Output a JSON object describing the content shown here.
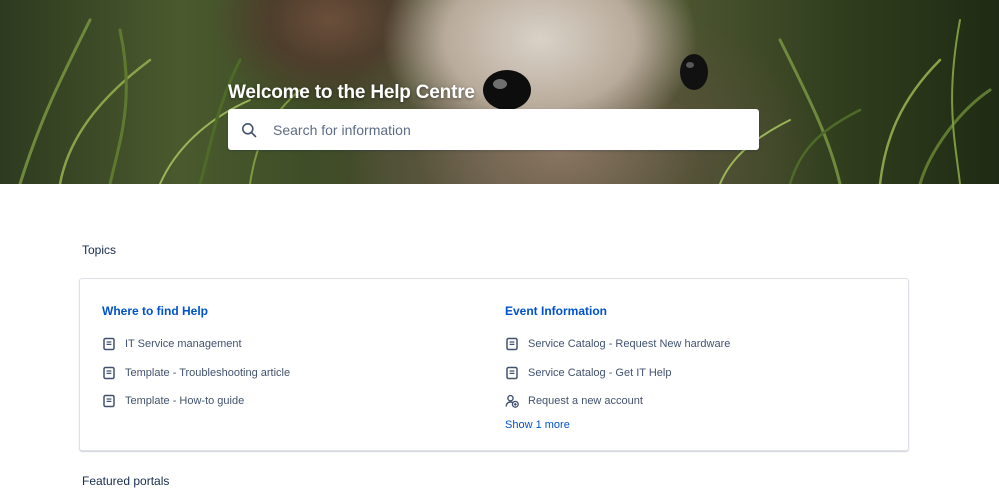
{
  "hero": {
    "title": "Welcome to the Help Centre"
  },
  "search": {
    "placeholder": "Search for information"
  },
  "topics": {
    "heading": "Topics",
    "columns": [
      {
        "title": "Where to find Help",
        "items": [
          {
            "label": "IT Service management",
            "icon": "article-icon"
          },
          {
            "label": "Template - Troubleshooting article",
            "icon": "article-icon"
          },
          {
            "label": "Template - How-to guide",
            "icon": "article-icon"
          }
        ]
      },
      {
        "title": "Event Information",
        "items": [
          {
            "label": "Service Catalog - Request New hardware",
            "icon": "article-icon"
          },
          {
            "label": "Service Catalog - Get IT Help",
            "icon": "article-icon"
          },
          {
            "label": "Request a new account",
            "icon": "add-user-icon"
          }
        ],
        "show_more": "Show 1 more"
      }
    ]
  },
  "featured": {
    "heading": "Featured portals"
  },
  "colors": {
    "link": "#0052cc",
    "text": "#172b4d",
    "muted": "#42526e"
  }
}
